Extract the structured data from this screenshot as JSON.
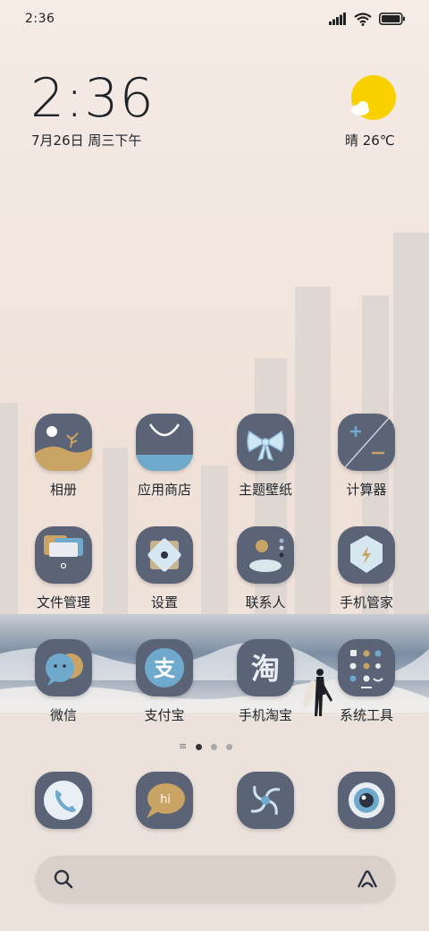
{
  "status_bar": {
    "time": "2:36"
  },
  "clock": {
    "time": "2:36",
    "date": "7月26日 周三下午"
  },
  "weather": {
    "text": "晴 26℃",
    "icon": "sun-cloud-icon",
    "sun_color": "#f9d100"
  },
  "apps": [
    {
      "label": "相册",
      "icon": "gallery-icon"
    },
    {
      "label": "应用商店",
      "icon": "app-store-bag-icon"
    },
    {
      "label": "主题壁纸",
      "icon": "theme-bow-icon"
    },
    {
      "label": "计算器",
      "icon": "calculator-icon"
    },
    {
      "label": "文件管理",
      "icon": "file-folder-icon"
    },
    {
      "label": "设置",
      "icon": "settings-icon"
    },
    {
      "label": "联系人",
      "icon": "contacts-icon"
    },
    {
      "label": "手机管家",
      "icon": "security-shield-icon"
    },
    {
      "label": "微信",
      "icon": "wechat-icon"
    },
    {
      "label": "支付宝",
      "icon": "alipay-icon",
      "glyph": "支"
    },
    {
      "label": "手机淘宝",
      "icon": "taobao-icon",
      "glyph": "淘"
    },
    {
      "label": "系统工具",
      "icon": "system-tools-icon"
    }
  ],
  "dock": [
    {
      "icon": "phone-icon"
    },
    {
      "icon": "messages-icon",
      "glyph": "hi"
    },
    {
      "icon": "browser-icon"
    },
    {
      "icon": "camera-icon"
    }
  ],
  "colors": {
    "icon_bg": "#5b6377",
    "accent_blue": "#6fa9cc",
    "accent_gold": "#c9a464"
  }
}
